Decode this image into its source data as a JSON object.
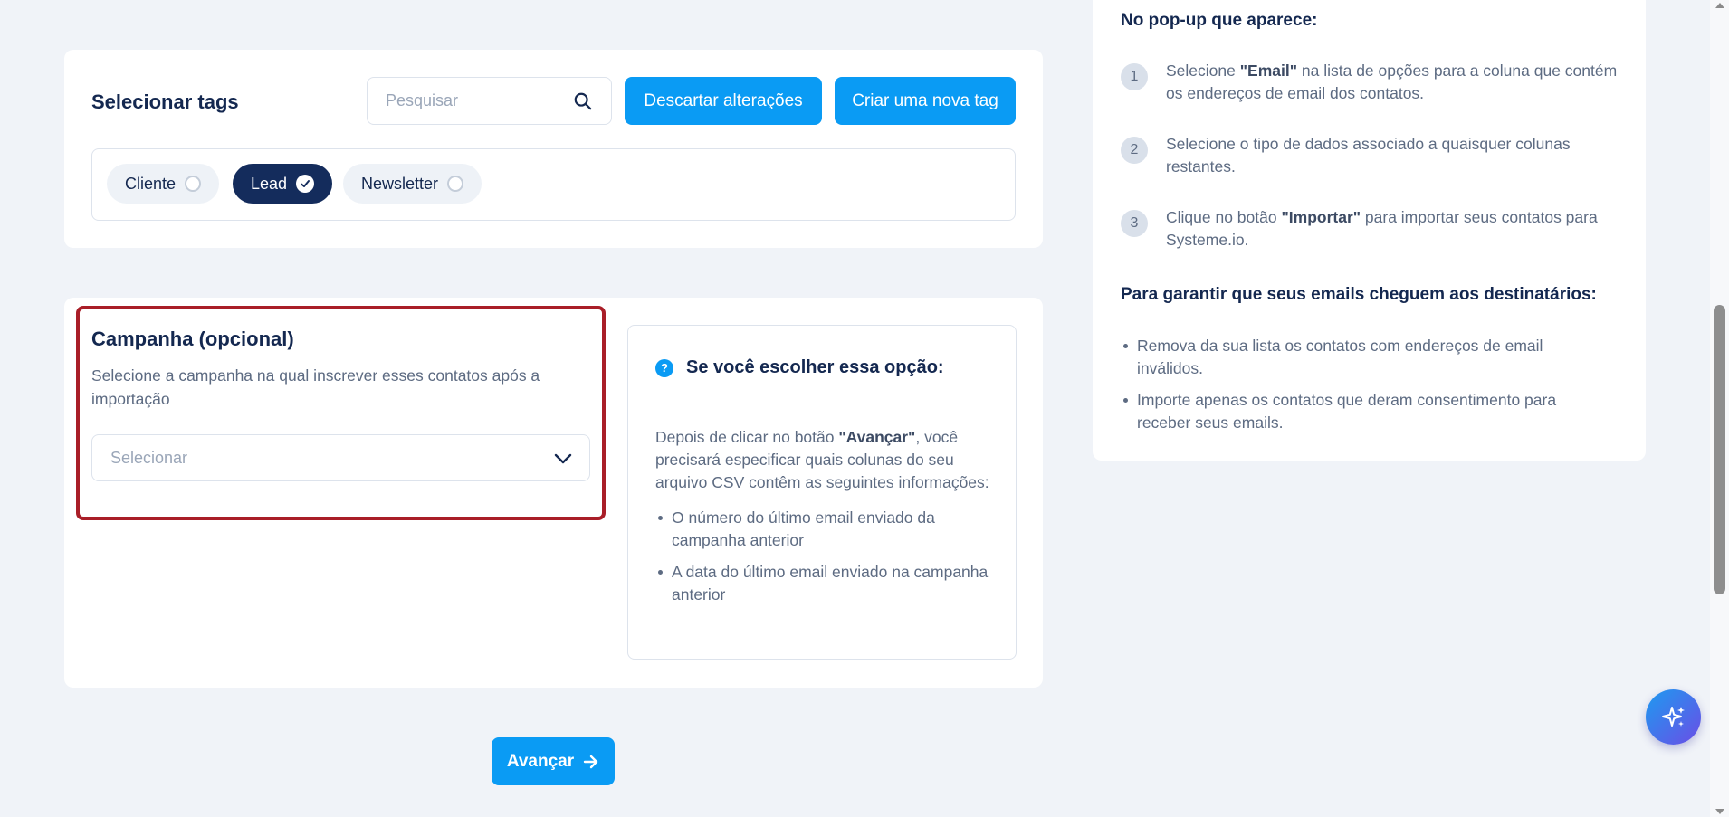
{
  "tags": {
    "title": "Selecionar tags",
    "search_placeholder": "Pesquisar",
    "discard_label": "Descartar alterações",
    "new_tag_label": "Criar uma nova tag",
    "items": [
      {
        "label": "Cliente",
        "selected": false
      },
      {
        "label": "Lead",
        "selected": true
      },
      {
        "label": "Newsletter",
        "selected": false
      }
    ]
  },
  "campaign": {
    "title": "Campanha (opcional)",
    "description": "Selecione a campanha na qual inscrever esses contatos após a importação",
    "select_value": "Selecionar"
  },
  "info": {
    "title": "Se você escolher essa opção:",
    "body_prefix": "Depois de clicar no botão ",
    "body_bold": "\"Avançar\"",
    "body_suffix": ", você precisará especificar quais colunas do seu arquivo CSV contêm as seguintes informações:",
    "bullets": [
      "O número do último email enviado da campanha anterior",
      "A data do último email enviado na campanha anterior"
    ]
  },
  "next_label": "Avançar",
  "right_panel": {
    "popup_title": "No pop-up que aparece:",
    "steps": [
      {
        "num": "1",
        "prefix": "Selecione ",
        "bold": "\"Email\"",
        "suffix": " na lista de opções para a coluna que contém os endereços de email dos contatos."
      },
      {
        "num": "2",
        "prefix": "Selecione o tipo de dados associado a quaisquer colunas restantes.",
        "bold": "",
        "suffix": ""
      },
      {
        "num": "3",
        "prefix": "Clique no botão ",
        "bold": "\"Importar\"",
        "suffix": " para importar seus contatos para Systeme.io."
      }
    ],
    "guarantee_title": "Para garantir que seus emails cheguem aos destinatários:",
    "guarantee_items": [
      "Remova da sua lista os contatos com endereços de email inválidos.",
      "Importe apenas os contatos que deram consentimento para receber seus emails."
    ]
  },
  "colors": {
    "primary": "#0a9bf4",
    "navy": "#142850",
    "highlight": "#a91e28"
  },
  "icons": {
    "search": "search-icon",
    "chevron": "chevron-down-icon",
    "check": "check-icon",
    "question": "question-icon",
    "arrow": "arrow-right-icon",
    "ai": "sparkle-icon"
  }
}
